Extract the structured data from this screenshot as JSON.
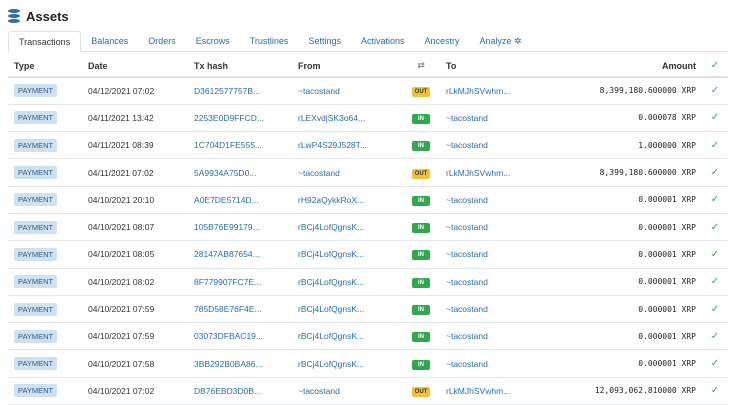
{
  "header": {
    "title": "Assets",
    "icon": "database-icon"
  },
  "tabs": [
    {
      "label": "Transactions",
      "active": true
    },
    {
      "label": "Balances"
    },
    {
      "label": "Orders"
    },
    {
      "label": "Escrows"
    },
    {
      "label": "Trustlines"
    },
    {
      "label": "Settings"
    },
    {
      "label": "Activations"
    },
    {
      "label": "Ancestry"
    },
    {
      "label": "Analyze ✲"
    }
  ],
  "table": {
    "headers": {
      "type": "Type",
      "date": "Date",
      "hash": "Tx hash",
      "from": "From",
      "dir": "⇄",
      "to": "To",
      "amount": "Amount",
      "check": "✓"
    },
    "rows": [
      {
        "type": "PAYMENT",
        "date": "04/12/2021 07:02",
        "hash": "D3612577757B...",
        "from": "~tacostand",
        "dir": "OUT",
        "to": "rLkMJhSVwhm...",
        "amount": "8,399,180.600000 XRP"
      },
      {
        "type": "PAYMENT",
        "date": "04/11/2021 13:42",
        "hash": "2253E0D9FFCD...",
        "from": "rLEXvdjSK3o64...",
        "dir": "IN",
        "to": "~tacostand",
        "amount": "0.000078 XRP"
      },
      {
        "type": "PAYMENT",
        "date": "04/11/2021 08:39",
        "hash": "1C704D1FE555...",
        "from": "rLwP4S29J528T...",
        "dir": "IN",
        "to": "~tacostand",
        "amount": "1.000000 XRP"
      },
      {
        "type": "PAYMENT",
        "date": "04/11/2021 07:02",
        "hash": "5A9934A75D0...",
        "from": "~tacostand",
        "dir": "OUT",
        "to": "rLkMJhSVwhm...",
        "amount": "8,399,180.600000 XRP"
      },
      {
        "type": "PAYMENT",
        "date": "04/10/2021 20:10",
        "hash": "A0E7DE5714D...",
        "from": "rH92aQykkRoX...",
        "dir": "IN",
        "to": "~tacostand",
        "amount": "0.000001 XRP"
      },
      {
        "type": "PAYMENT",
        "date": "04/10/2021 08:07",
        "hash": "105B76E99179...",
        "from": "rBCj4LofQgnsK...",
        "dir": "IN",
        "to": "~tacostand",
        "amount": "0.000001 XRP"
      },
      {
        "type": "PAYMENT",
        "date": "04/10/2021 08:05",
        "hash": "28147AB87654...",
        "from": "rBCj4LofQgnsK...",
        "dir": "IN",
        "to": "~tacostand",
        "amount": "0.000001 XRP"
      },
      {
        "type": "PAYMENT",
        "date": "04/10/2021 08:02",
        "hash": "8F779907FC7E...",
        "from": "rBCj4LofQgnsK...",
        "dir": "IN",
        "to": "~tacostand",
        "amount": "0.000001 XRP"
      },
      {
        "type": "PAYMENT",
        "date": "04/10/2021 07:59",
        "hash": "785D58E76F4E...",
        "from": "rBCj4LofQgnsK...",
        "dir": "IN",
        "to": "~tacostand",
        "amount": "0.000001 XRP"
      },
      {
        "type": "PAYMENT",
        "date": "04/10/2021 07:59",
        "hash": "03073DFBAC19...",
        "from": "rBCj4LofQgnsK...",
        "dir": "IN",
        "to": "~tacostand",
        "amount": "0.000001 XRP"
      },
      {
        "type": "PAYMENT",
        "date": "04/10/2021 07:58",
        "hash": "3BB292B0BA86...",
        "from": "rBCj4LofQgnsK...",
        "dir": "IN",
        "to": "~tacostand",
        "amount": "0.000001 XRP"
      },
      {
        "type": "PAYMENT",
        "date": "04/10/2021 07:02",
        "hash": "DB76EBD3D0B...",
        "from": "~tacostand",
        "dir": "OUT",
        "to": "rLkMJhSVwhm...",
        "amount": "12,093,062.810000 XRP"
      }
    ]
  },
  "colors": {
    "link": "#2a6ea6",
    "in": "#2fa84f",
    "out": "#f2c230",
    "type_badge": "#cfe1f0"
  }
}
